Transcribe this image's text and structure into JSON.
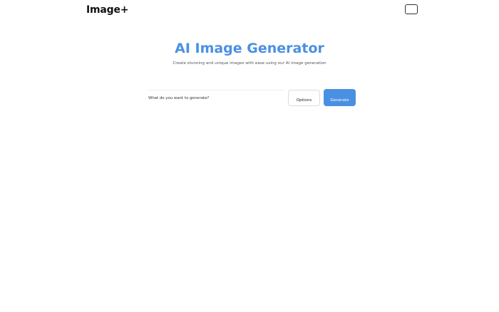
{
  "header": {
    "logo_text": "Image+",
    "menu_icon": "menu-icon"
  },
  "hero": {
    "title": "AI Image Generator",
    "subtitle": "Create stunning and unique images with ease using our AI image generation"
  },
  "prompt": {
    "placeholder": "What do you want to generate?",
    "value": ""
  },
  "actions": {
    "options_label": "Options",
    "generate_label": "Generate"
  },
  "colors": {
    "accent": "#4a90e2",
    "background": "#ffffff"
  }
}
